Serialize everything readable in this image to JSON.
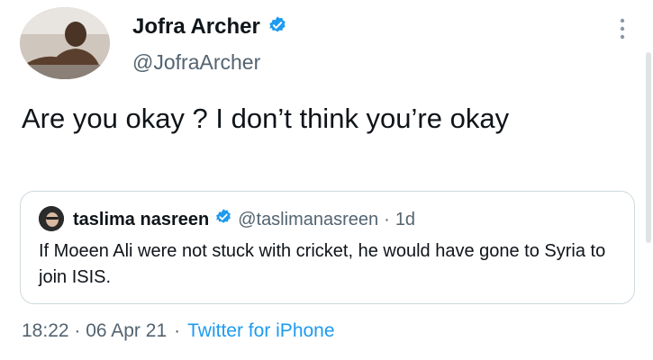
{
  "author": {
    "display_name": "Jofra Archer",
    "handle": "@JofraArcher",
    "verified": true
  },
  "tweet": {
    "text": "Are you okay ? I don’t think you’re okay"
  },
  "quoted_tweet": {
    "display_name": "taslima nasreen",
    "handle": "@taslimanasreen",
    "separator": "·",
    "time": "1d",
    "verified": true,
    "text": "If Moeen Ali were not stuck with cricket,  he would have gone to Syria to join ISIS."
  },
  "meta": {
    "time": "18:22 · 06 Apr 21",
    "separator": "·",
    "source": "Twitter for iPhone"
  },
  "icons": {
    "verified": "verified-badge-icon",
    "more": "more-options-icon"
  },
  "colors": {
    "verified": "#1d9bf0",
    "link": "#1d9bf0",
    "secondary_text": "#536471",
    "border": "#cfd9de"
  }
}
